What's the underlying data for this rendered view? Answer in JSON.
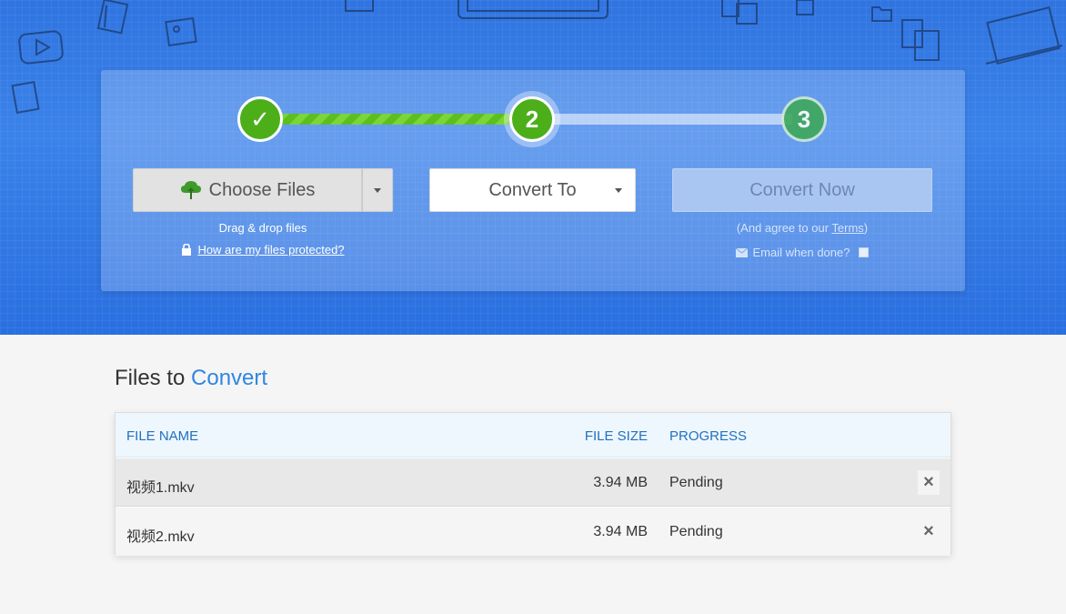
{
  "steps": {
    "step1": "✓",
    "step2": "2",
    "step3": "3"
  },
  "toolbar": {
    "choose_files_label": "Choose Files",
    "convert_to_label": "Convert To",
    "convert_now_label": "Convert Now"
  },
  "hints": {
    "drag_drop": "Drag & drop files",
    "protected_link": "How are my files protected?",
    "agree_prefix": "(And agree to our ",
    "terms_link": "Terms",
    "agree_suffix": ")",
    "email_label": "Email when done?"
  },
  "files_section": {
    "title_prefix": "Files to ",
    "title_accent": "Convert"
  },
  "table": {
    "columns": {
      "name": "FILE NAME",
      "size": "FILE SIZE",
      "progress": "PROGRESS"
    },
    "rows": [
      {
        "name": "视频1.mkv",
        "size": "3.94 MB",
        "progress": "Pending",
        "remove": "×"
      },
      {
        "name": "视频2.mkv",
        "size": "3.94 MB",
        "progress": "Pending",
        "remove": "×"
      }
    ]
  },
  "colors": {
    "hero_blue": "#3079e3",
    "step_green": "#4caf1a",
    "accent_blue": "#2f86e0",
    "header_text": "#2270c0"
  },
  "icons": {
    "cloud": "cloud-upload-icon",
    "lock": "lock-icon",
    "envelope": "envelope-icon",
    "caret": "caret-down-icon",
    "remove": "close-icon"
  }
}
